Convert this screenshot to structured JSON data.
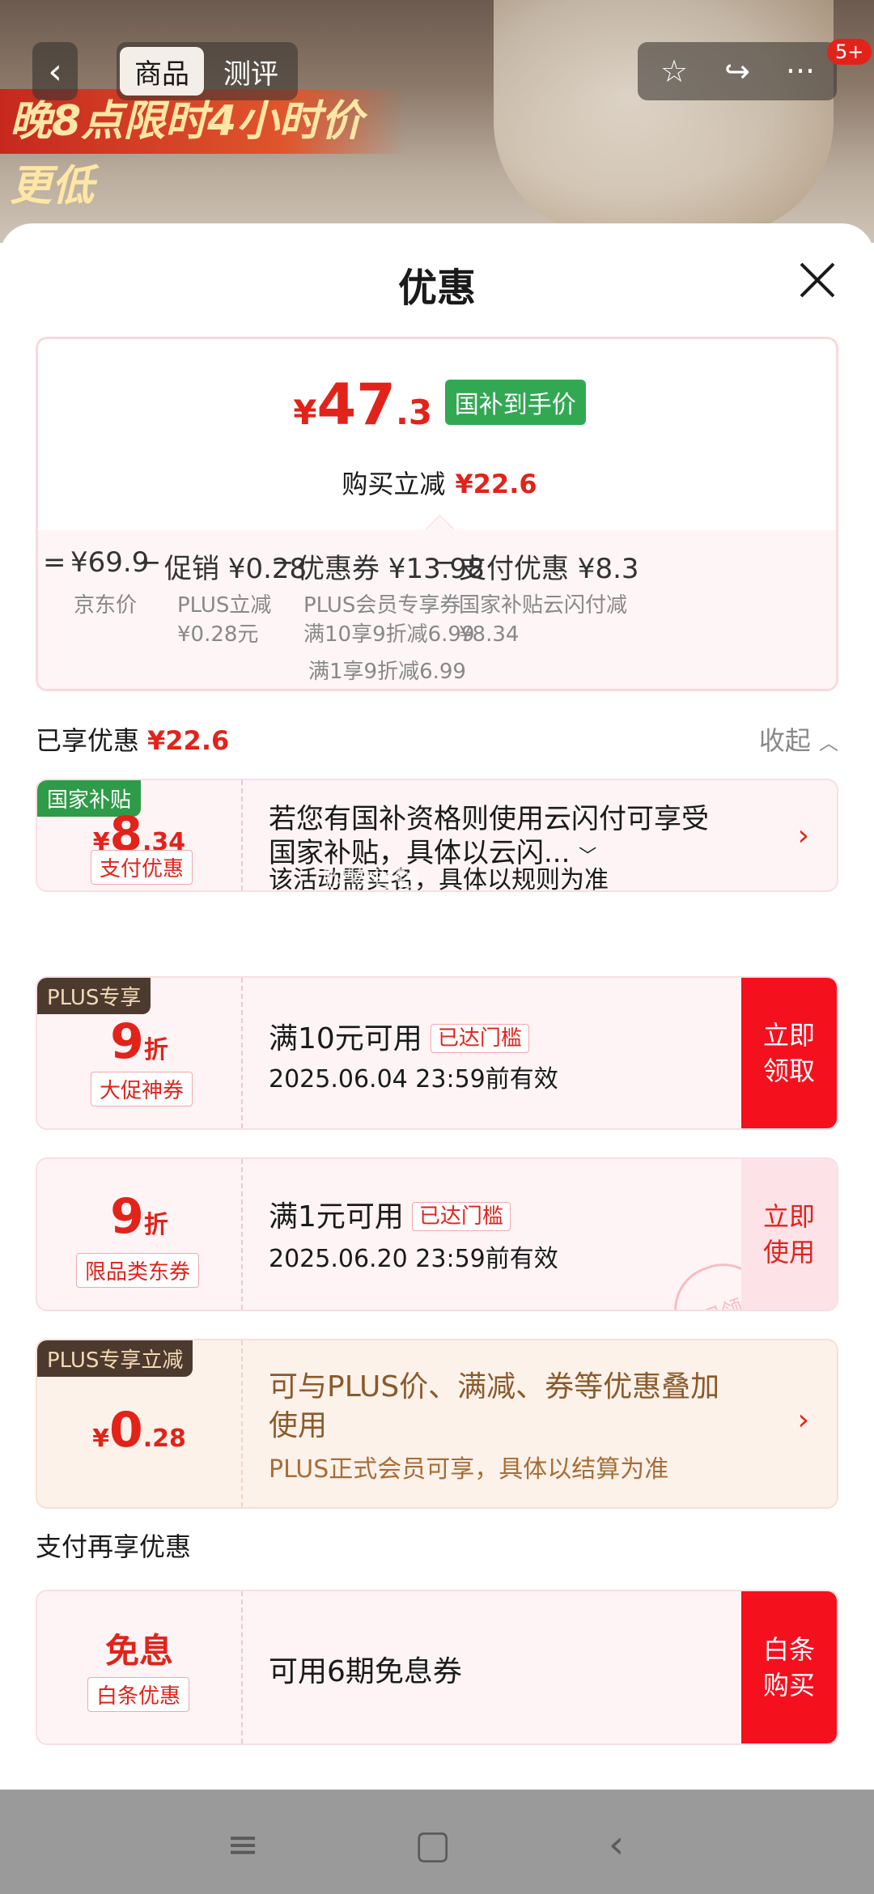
{
  "header": {
    "promo_text": "晚8点限时4小时价更低",
    "tabs": [
      {
        "label": "商品"
      },
      {
        "label": "测评"
      }
    ],
    "badge": "5+"
  },
  "sheet": {
    "title": "优惠"
  },
  "price_card": {
    "currency": "¥",
    "final_int": "47",
    "final_dec": ".3",
    "final_tag": "国补到手价",
    "reduce_label": "购买立减",
    "reduce_value": "¥22.6",
    "breakdown": [
      {
        "op": "=",
        "label": "¥69.9",
        "sub1": "京东价",
        "sub2": "",
        "sub3": ""
      },
      {
        "op": "−",
        "label": "促销 ¥0.28",
        "sub1": "PLUS立减",
        "sub2": "¥0.28元",
        "sub3": ""
      },
      {
        "op": "−",
        "label": "优惠券 ¥13.98",
        "sub1": "PLUS会员专享券",
        "sub2": "满10享9折减6.99",
        "sub3": "满1享9折减6.99"
      },
      {
        "op": "−",
        "label": "支付优惠 ¥8.3",
        "sub1": "国家补贴云闪付减",
        "sub2": "¥8.34",
        "sub3": ""
      }
    ]
  },
  "enjoyed": {
    "label": "已享优惠",
    "value": "¥22.6",
    "collapse_label": "收起"
  },
  "coupons": [
    {
      "corner_tag": "国家补贴",
      "currency": "¥",
      "value_int": "8",
      "value_dec": ".34",
      "type_label": "支付优惠",
      "title_line1": "若您有国补资格则使用云闪付可享受",
      "title_line2": "国家补贴，具体以云闪...",
      "desc": "该活动需实名，具体以规则为准",
      "watermark": "购物省钱"
    },
    {
      "corner_tag": "PLUS专享",
      "value_int": "9",
      "value_unit": "折",
      "type_label": "大促神券",
      "title": "满10元可用",
      "threshold": "已达门槛",
      "desc": "2025.06.04 23:59前有效",
      "action": "立即领取"
    },
    {
      "value_int": "9",
      "value_unit": "折",
      "type_label": "限品类东券",
      "title": "满1元可用",
      "threshold": "已达门槛",
      "desc": "2025.06.20 23:59前有效",
      "action": "立即使用",
      "stamp": "已领"
    },
    {
      "corner_tag": "PLUS专享立减",
      "currency": "¥",
      "value_int": "0",
      "value_dec": ".28",
      "title_line1": "可与PLUS价、满减、券等优惠叠加",
      "title_line2": "使用",
      "desc": "PLUS正式会员可享，具体以结算为准"
    }
  ],
  "payment": {
    "section_label": "支付再享优惠",
    "big_label": "免息",
    "type_label": "白条优惠",
    "title": "可用6期免息券",
    "action": "白条购买"
  },
  "colors": {
    "accent_red": "#e2231a",
    "subsidy_green": "#33a853",
    "plus_dark": "#4d3a2f"
  }
}
